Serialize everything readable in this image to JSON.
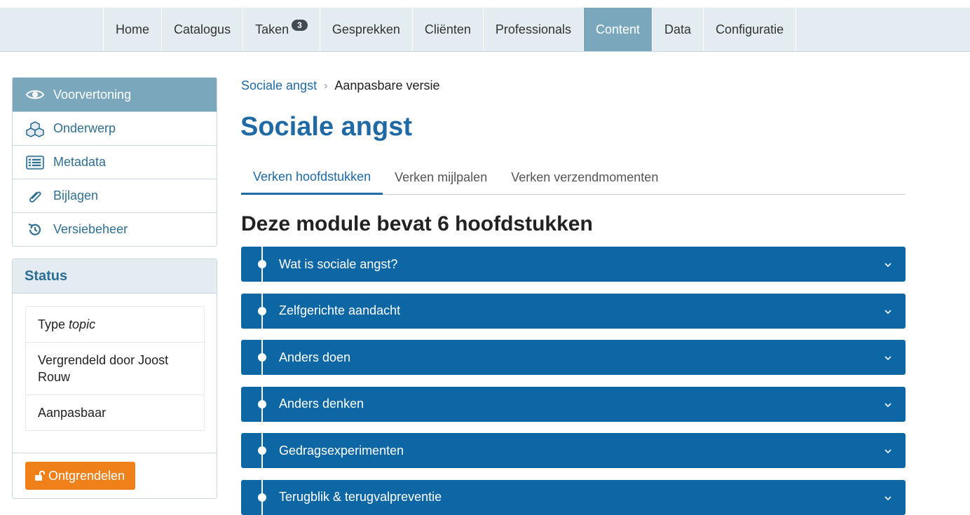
{
  "nav": {
    "items": [
      {
        "label": "Home"
      },
      {
        "label": "Catalogus"
      },
      {
        "label": "Taken",
        "badge": "3"
      },
      {
        "label": "Gesprekken"
      },
      {
        "label": "Cliënten"
      },
      {
        "label": "Professionals"
      },
      {
        "label": "Content",
        "active": true
      },
      {
        "label": "Data"
      },
      {
        "label": "Configuratie"
      }
    ]
  },
  "sidebar": {
    "items": [
      {
        "label": "Voorvertoning",
        "icon": "eye-icon",
        "active": true
      },
      {
        "label": "Onderwerp",
        "icon": "cubes-icon"
      },
      {
        "label": "Metadata",
        "icon": "list-alt-icon"
      },
      {
        "label": "Bijlagen",
        "icon": "paperclip-icon"
      },
      {
        "label": "Versiebeheer",
        "icon": "history-icon"
      }
    ]
  },
  "status": {
    "title": "Status",
    "type_prefix": "Type",
    "type_value": "topic",
    "locked_by": "Vergrendeld door Joost Rouw",
    "editable": "Aanpasbaar",
    "unlock_label": "Ontgrendelen"
  },
  "breadcrumb": {
    "parent": "Sociale angst",
    "current": "Aanpasbare versie"
  },
  "page_title": "Sociale angst",
  "tabs": [
    {
      "label": "Verken hoofdstukken",
      "active": true
    },
    {
      "label": "Verken mijlpalen"
    },
    {
      "label": "Verken verzendmomenten"
    }
  ],
  "section_title": "Deze module bevat 6 hoofdstukken",
  "chapters": [
    {
      "label": "Wat is sociale angst?"
    },
    {
      "label": "Zelfgerichte aandacht"
    },
    {
      "label": "Anders doen"
    },
    {
      "label": "Anders denken"
    },
    {
      "label": "Gedragsexperimenten"
    },
    {
      "label": "Terugblik & terugvalpreventie"
    }
  ],
  "colors": {
    "primary": "#1f6aa5",
    "chapter_bg": "#0e67a5",
    "active_nav": "#7aa7bb",
    "unlock_button": "#f0811a"
  }
}
